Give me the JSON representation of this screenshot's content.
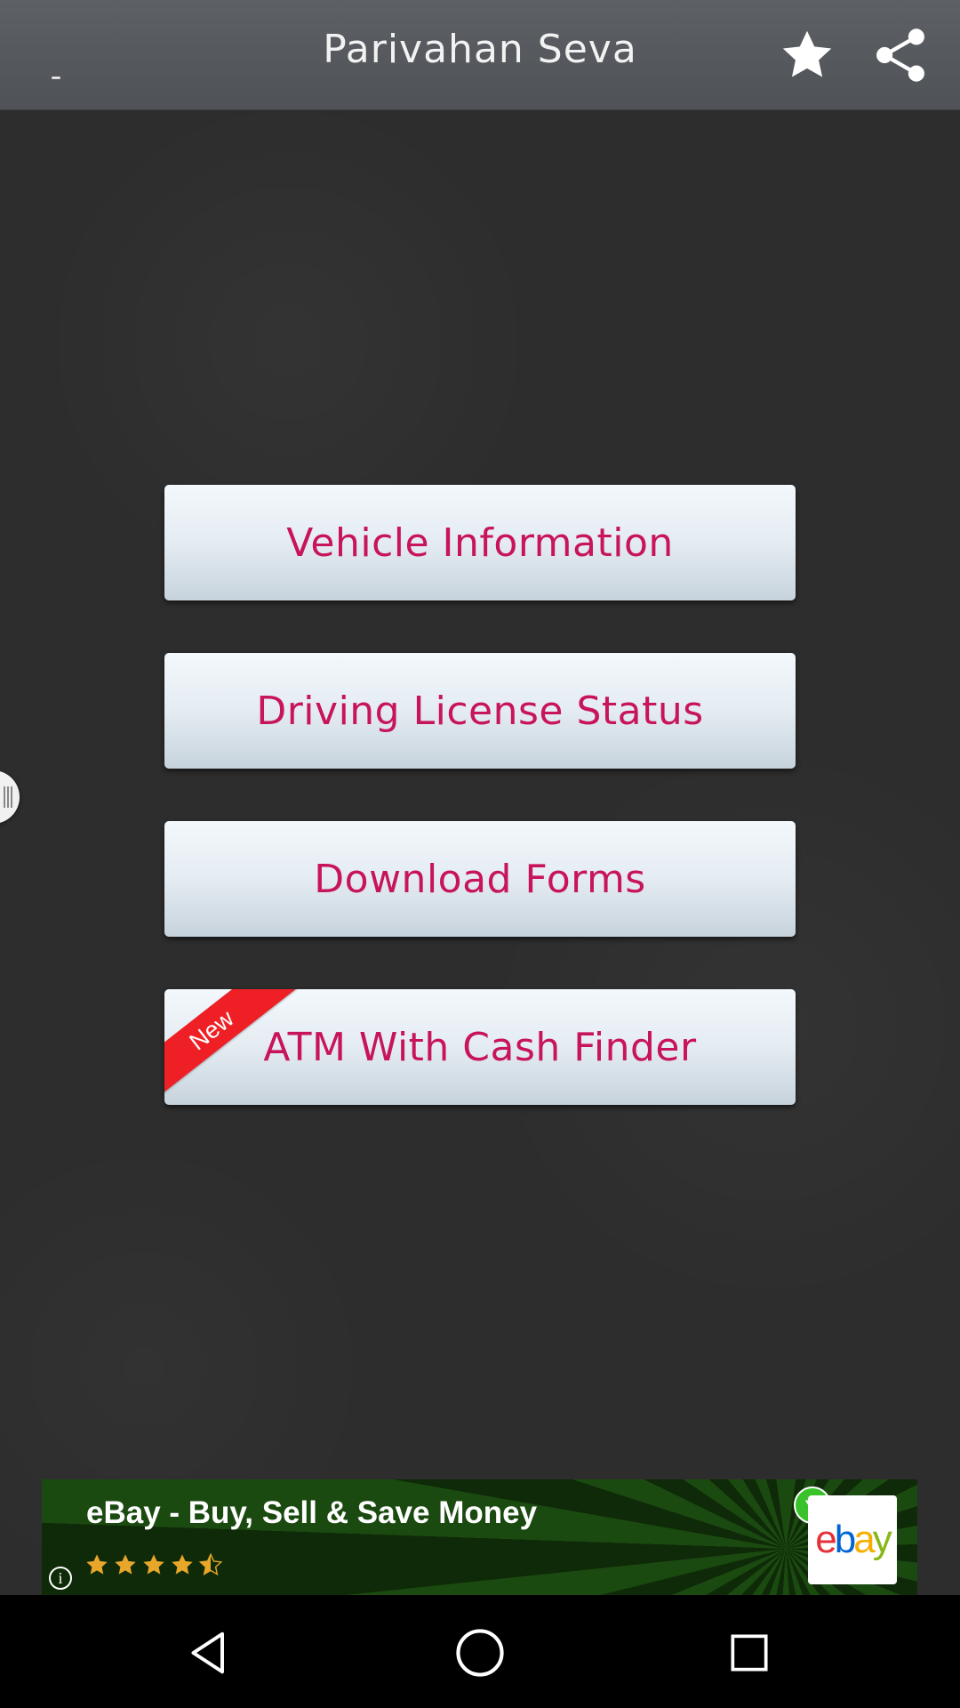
{
  "app": {
    "title": "Parivahan Seva"
  },
  "toolbar": {
    "favorite_icon": "star-icon",
    "share_icon": "share-icon"
  },
  "menu": {
    "buttons": [
      {
        "label": "Vehicle Information"
      },
      {
        "label": "Driving License Status"
      },
      {
        "label": "Download Forms"
      },
      {
        "label": "ATM With Cash Finder",
        "badge": "New"
      }
    ]
  },
  "ad": {
    "title": "eBay - Buy, Sell & Save Money",
    "rating": 4.5,
    "info_icon": "i",
    "logo": {
      "e": "e",
      "b": "b",
      "a": "a",
      "y": "y"
    }
  },
  "colors": {
    "accent_text": "#c8145a",
    "ribbon": "#ee1f25",
    "topbar": "#55585c"
  }
}
